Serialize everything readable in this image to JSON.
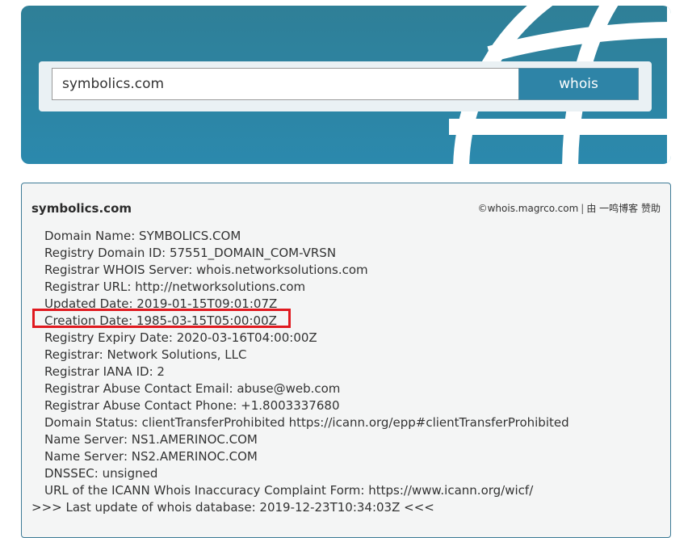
{
  "search": {
    "value": "symbolics.com",
    "button_label": "whois"
  },
  "result": {
    "title": "symbolics.com",
    "credit": {
      "site": "©whois.magrco.com",
      "separator": "|",
      "by_label": "由 一鸣博客",
      "sponsor_label": "赞助"
    },
    "lines": [
      "Domain Name: SYMBOLICS.COM",
      "Registry Domain ID: 57551_DOMAIN_COM-VRSN",
      "Registrar WHOIS Server: whois.networksolutions.com",
      "Registrar URL: http://networksolutions.com",
      "Updated Date: 2019-01-15T09:01:07Z",
      "Creation Date: 1985-03-15T05:00:00Z",
      "Registry Expiry Date: 2020-03-16T04:00:00Z",
      "Registrar: Network Solutions, LLC",
      "Registrar IANA ID: 2",
      "Registrar Abuse Contact Email: abuse@web.com",
      "Registrar Abuse Contact Phone: +1.8003337680",
      "Domain Status: clientTransferProhibited https://icann.org/epp#clientTransferProhibited",
      "Name Server: NS1.AMERINOC.COM",
      "Name Server: NS2.AMERINOC.COM",
      "DNSSEC: unsigned",
      "URL of the ICANN Whois Inaccuracy Complaint Form: https://www.icann.org/wicf/"
    ],
    "footer_line": ">>> Last update of whois database: 2019-12-23T10:34:03Z <<<"
  },
  "colors": {
    "hero_background": "#2b89ad",
    "button_background": "#2e84a7",
    "highlight": "#e0191f"
  },
  "icons": {
    "hero_decoration": "globe-icon"
  }
}
